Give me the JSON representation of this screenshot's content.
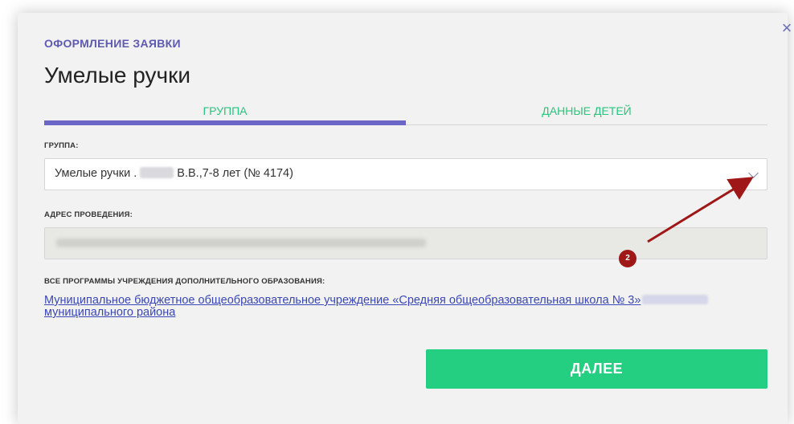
{
  "modal": {
    "close_symbol": "×",
    "kicker": "ОФОРМЛЕНИЕ ЗАЯВКИ",
    "title": "Умелые ручки"
  },
  "tabs": [
    {
      "label": "ГРУППА",
      "active": true
    },
    {
      "label": "ДАННЫЕ ДЕТЕЙ",
      "active": false
    }
  ],
  "group_field": {
    "label": "ГРУППА:",
    "value_prefix": "Умелые ручки .",
    "value_suffix": "В.В.,7-8 лет (№ 4174)",
    "chevron_icon": "chevron-down-icon"
  },
  "address_field": {
    "label": "АДРЕС ПРОВЕДЕНИЯ:"
  },
  "programs": {
    "label": "ВСЕ ПРОГРАММЫ УЧРЕЖДЕНИЯ ДОПОЛНИТЕЛЬНОГО ОБРАЗОВАНИЯ:",
    "link_part1": "Муниципальное бюджетное общеобразовательное учреждение «Средняя общеобразовательная школа № 3»",
    "link_part2": "муниципального района"
  },
  "next_button": {
    "label": "ДАЛЕЕ"
  },
  "annotation": {
    "step_number": "2"
  },
  "colors": {
    "accent_purple": "#6c66c6",
    "accent_green": "#25cf81",
    "link_blue": "#3b47b6",
    "annotation_red": "#a01717"
  }
}
